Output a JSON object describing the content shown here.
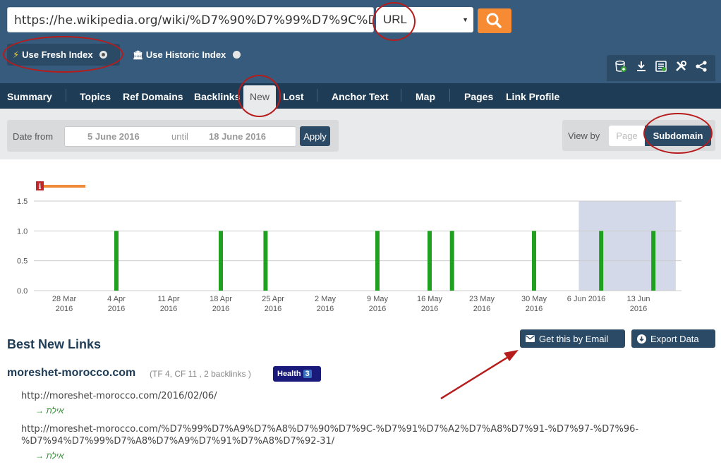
{
  "search": {
    "url_value": "https://he.wikipedia.org/wiki/%D7%90%D7%99%D7%9C%D",
    "mode": "URL",
    "search_icon": "search-icon"
  },
  "index": {
    "fresh_label": "Use Fresh Index",
    "historic_label": "Use Historic Index",
    "selected": "fresh"
  },
  "toolbar": {
    "icons": [
      "bucket-add-icon",
      "download-icon",
      "report-icon",
      "tools-icon",
      "share-icon"
    ]
  },
  "tabs": [
    "Summary",
    "Topics",
    "Ref Domains",
    "Backlinks",
    "New",
    "Lost",
    "Anchor Text",
    "Map",
    "Pages",
    "Link Profile"
  ],
  "active_tab": "New",
  "date_filter": {
    "label": "Date from",
    "from": "5 June 2016",
    "until_label": "until",
    "to": "18 June 2016",
    "apply_label": "Apply"
  },
  "view_by": {
    "label": "View by",
    "options": [
      "Page",
      "Subdomain"
    ],
    "selected": "Subdomain"
  },
  "chart_data": {
    "type": "bar",
    "y_ticks": [
      "0.0",
      "0.5",
      "1.0",
      "1.5"
    ],
    "ylim": [
      0,
      1.5
    ],
    "x_ticks": [
      [
        "28 Mar",
        "2016"
      ],
      [
        "4 Apr",
        "2016"
      ],
      [
        "11 Apr",
        "2016"
      ],
      [
        "18 Apr",
        "2016"
      ],
      [
        "25 Apr",
        "2016"
      ],
      [
        "2 May",
        "2016"
      ],
      [
        "9 May",
        "2016"
      ],
      [
        "16 May",
        "2016"
      ],
      [
        "23 May",
        "2016"
      ],
      [
        "30 May",
        "2016"
      ],
      [
        "6 Jun 2016",
        ""
      ],
      [
        "13 Jun",
        "2016"
      ]
    ],
    "bars": [
      {
        "date": "2016-04-04",
        "value": 1
      },
      {
        "date": "2016-04-18",
        "value": 1
      },
      {
        "date": "2016-04-24",
        "value": 1
      },
      {
        "date": "2016-05-09",
        "value": 1
      },
      {
        "date": "2016-05-16",
        "value": 1
      },
      {
        "date": "2016-05-19",
        "value": 1
      },
      {
        "date": "2016-05-30",
        "value": 1
      },
      {
        "date": "2016-06-08",
        "value": 1
      },
      {
        "date": "2016-06-15",
        "value": 1
      }
    ],
    "highlight_range": [
      "2016-06-05",
      "2016-06-18"
    ],
    "bar_color": "#1fa01f",
    "highlight_color": "#d3d9e8",
    "info_marker": "i"
  },
  "results": {
    "title": "Best New Links",
    "email_label": "Get this by Email",
    "export_label": "Export Data",
    "domain": "moreshet-morocco.com",
    "domain_meta": "(TF 4, CF 11 , 2 backlinks )",
    "health_label": "Health",
    "health_count": "3",
    "links": [
      {
        "url": "http://moreshet-morocco.com/2016/02/06/",
        "anchor": "→ אילת"
      },
      {
        "url": "http://moreshet-morocco.com/%D7%99%D7%A9%D7%A8%D7%90%D7%9C-%D7%91%D7%A2%D7%A8%D7%91-%D7%97-%D7%96-",
        "url_cont": "%D7%94%D7%99%D7%A8%D7%A9%D7%91%D7%A8%D7%92-31/",
        "anchor": "→ אילת"
      }
    ]
  }
}
